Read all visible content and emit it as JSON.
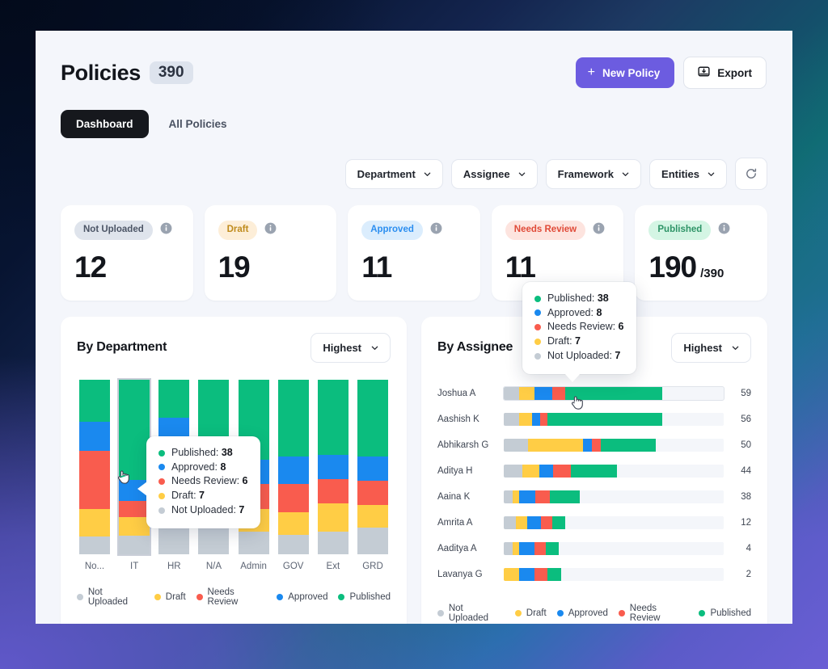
{
  "header": {
    "title": "Policies",
    "count": "390",
    "new_policy_label": "New Policy",
    "new_policy_plus": "+",
    "export_label": "Export",
    "accent": "#6c5ce0"
  },
  "tabs": [
    {
      "label": "Dashboard",
      "active": true
    },
    {
      "label": "All Policies",
      "active": false
    }
  ],
  "filters": [
    {
      "label": "Department"
    },
    {
      "label": "Assignee"
    },
    {
      "label": "Framework"
    },
    {
      "label": "Entities"
    }
  ],
  "refresh": {
    "name": "refresh-icon"
  },
  "stats": [
    {
      "badge": "Not Uploaded",
      "value": "12",
      "denominator": "",
      "badge_bg": "#dfe4ec",
      "badge_fg": "#4c5566"
    },
    {
      "badge": "Draft",
      "value": "19",
      "denominator": "",
      "badge_bg": "#fdeed8",
      "badge_fg": "#bf8b1c"
    },
    {
      "badge": "Approved",
      "value": "11",
      "denominator": "",
      "badge_bg": "#dbedfd",
      "badge_fg": "#2b8ef0"
    },
    {
      "badge": "Needs Review",
      "value": "11",
      "denominator": "",
      "badge_bg": "#fde4df",
      "badge_fg": "#e04a38"
    },
    {
      "badge": "Published",
      "value": "190",
      "denominator": "/390",
      "badge_bg": "#d4f5e4",
      "badge_fg": "#2e9467"
    }
  ],
  "status_colors": {
    "Published": "#0bbd7e",
    "Approved": "#1a89ef",
    "Needs Review": "#f95c4e",
    "Draft": "#ffcd45",
    "Not Uploaded": "#c4ccd4"
  },
  "department_panel": {
    "title": "By Department",
    "sort_label": "Highest",
    "legend": [
      "Not Uploaded",
      "Draft",
      "Needs Review",
      "Approved",
      "Published"
    ]
  },
  "assignee_panel": {
    "title": "By Assignee",
    "sort_label": "Highest",
    "legend": [
      "Not Uploaded",
      "Draft",
      "Approved",
      "Needs Review",
      "Published"
    ]
  },
  "tooltip": {
    "rows": [
      {
        "label": "Published",
        "value": "38"
      },
      {
        "label": "Approved",
        "value": "8"
      },
      {
        "label": "Needs Review",
        "value": "6"
      },
      {
        "label": "Draft",
        "value": "7"
      },
      {
        "label": "Not Uploaded",
        "value": "7"
      }
    ]
  },
  "chart_data": [
    {
      "type": "bar",
      "title": "By Department",
      "stacked": true,
      "orientation": "vertical",
      "categories": [
        "No...",
        "IT",
        "HR",
        "N/A",
        "Admin",
        "GOV",
        "Ext",
        "GRD"
      ],
      "series": [
        {
          "name": "Published",
          "color": "#0bbd7e",
          "values": [
            24,
            38,
            22,
            42,
            46,
            44,
            43,
            44
          ]
        },
        {
          "name": "Approved",
          "color": "#1a89ef",
          "values": [
            17,
            8,
            22,
            10,
            14,
            16,
            14,
            14
          ]
        },
        {
          "name": "Needs Review",
          "color": "#f95c4e",
          "values": [
            33,
            6,
            25,
            3,
            14,
            16,
            14,
            14
          ]
        },
        {
          "name": "Draft",
          "color": "#ffcd45",
          "values": [
            16,
            7,
            14,
            19,
            13,
            13,
            16,
            13
          ]
        },
        {
          "name": "Not Uploaded",
          "color": "#c4ccd4",
          "values": [
            10,
            7,
            17,
            26,
            13,
            11,
            13,
            15
          ]
        }
      ],
      "selected_category": "IT",
      "xlabel": "",
      "ylabel": "",
      "grid": false,
      "legend_position": "bottom"
    },
    {
      "type": "bar",
      "title": "By Assignee",
      "stacked": true,
      "orientation": "horizontal",
      "max": 100,
      "categories": [
        "Joshua A",
        "Aashish K",
        "Abhikarsh G",
        "Aditya H",
        "Aaina K",
        "Amrita A",
        "Aaditya A",
        "Lavanya G"
      ],
      "totals": [
        "59",
        "56",
        "50",
        "44",
        "38",
        "12",
        "4",
        "2"
      ],
      "series": [
        {
          "name": "Not Uploaded",
          "color": "#c4ccd4",
          "values": [
            7.0,
            7.0,
            11.0,
            8.5,
            4.0,
            5.5,
            4.0,
            0.0
          ]
        },
        {
          "name": "Draft",
          "color": "#ffcd45",
          "values": [
            7.0,
            6.0,
            25.0,
            7.5,
            3.0,
            5.0,
            3.0,
            7.0
          ]
        },
        {
          "name": "Approved",
          "color": "#1a89ef",
          "values": [
            8.0,
            3.5,
            4.0,
            6.5,
            7.5,
            6.5,
            7.0,
            7.0
          ]
        },
        {
          "name": "Needs Review",
          "color": "#f95c4e",
          "values": [
            6.0,
            3.5,
            4.0,
            8.0,
            6.5,
            5.0,
            5.0,
            6.0
          ]
        },
        {
          "name": "Published",
          "color": "#0bbd7e",
          "values": [
            44.0,
            52.0,
            25.0,
            21.0,
            13.5,
            6.0,
            6.0,
            6.0
          ]
        }
      ],
      "selected_category": "Joshua A",
      "grid": false,
      "legend_position": "bottom"
    }
  ]
}
